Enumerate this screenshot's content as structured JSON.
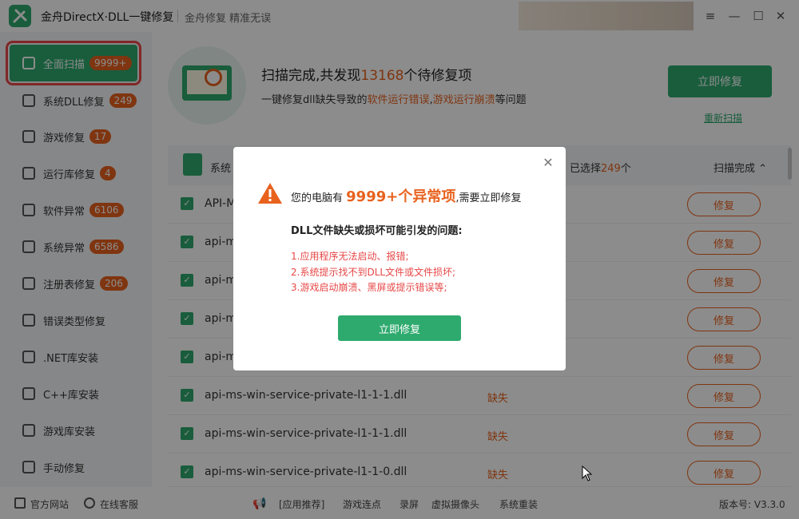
{
  "app": {
    "title": "金舟DirectX·DLL一键修复",
    "slogan": "金舟修复 精准无误",
    "window_controls": [
      "≡",
      "—",
      "☐",
      "✕"
    ]
  },
  "sidebar": {
    "active": {
      "label": "全面扫描",
      "badge": "9999+"
    },
    "items": [
      {
        "label": "系统DLL修复",
        "badge": "249",
        "icon": "dll-icon"
      },
      {
        "label": "游戏修复",
        "badge": "17",
        "icon": "gamepad-icon"
      },
      {
        "label": "运行库修复",
        "badge": "4",
        "icon": "visual-studio-icon"
      },
      {
        "label": "软件异常",
        "badge": "6106",
        "icon": "code-icon"
      },
      {
        "label": "系统异常",
        "badge": "6586",
        "icon": "gear-icon"
      },
      {
        "label": "注册表修复",
        "badge": "206",
        "icon": "registry-icon"
      },
      {
        "label": "错误类型修复",
        "badge": "",
        "icon": "warning-icon"
      },
      {
        "label": ".NET库安装",
        "badge": "",
        "icon": "dotnet-icon"
      },
      {
        "label": "C++库安装",
        "badge": "",
        "icon": "cpp-icon"
      },
      {
        "label": "游戏库安装",
        "badge": "",
        "icon": "pacman-icon"
      },
      {
        "label": "手动修复",
        "badge": "",
        "icon": "tools-icon"
      }
    ]
  },
  "scan": {
    "title_prefix": "扫描完成,共发现",
    "count": "13168",
    "title_suffix": "个待修复项",
    "sub_prefix": "一键修复dll缺失导致的",
    "sub_hl1": "软件运行错误",
    "sub_sep": ",",
    "sub_hl2": "游戏运行崩溃",
    "sub_suffix": "等问题",
    "fix_button": "立即修复",
    "rescan": "重新扫描"
  },
  "list": {
    "col_name": "系统",
    "selected_prefix": "已选择",
    "selected_count": "249",
    "selected_suffix": "个",
    "status": "扫描完成",
    "rows": [
      {
        "name": "API-M",
        "state": "",
        "fix": "修复"
      },
      {
        "name": "api-m",
        "state": "",
        "fix": "修复"
      },
      {
        "name": "api-m",
        "state": "",
        "fix": "修复"
      },
      {
        "name": "api-m",
        "state": "",
        "fix": "修复"
      },
      {
        "name": "api-m",
        "state": "",
        "fix": "修复"
      },
      {
        "name": "api-ms-win-service-private-l1-1-1.dll",
        "state": "缺失",
        "fix": "修复"
      },
      {
        "name": "api-ms-win-service-private-l1-1-1.dll",
        "state": "缺失",
        "fix": "修复"
      },
      {
        "name": "api-ms-win-service-private-l1-1-0.dll",
        "state": "缺失",
        "fix": "修复"
      }
    ]
  },
  "modal": {
    "head_prefix": "您的电脑有",
    "head_count": "9999+个异常项",
    "head_suffix": ",需要立即修复",
    "sub": "DLL文件缺失或损坏可能引发的问题:",
    "issues": [
      "1.应用程序无法启动、报错;",
      "2.系统提示找不到DLL文件或文件损坏;",
      "3.游戏启动崩溃、黑屏或提示错误等;"
    ],
    "button": "立即修复"
  },
  "footer": {
    "website": "官方网站",
    "support": "在线客服",
    "recommend": "[应用推荐]",
    "links": [
      "游戏连点",
      "录屏",
      "虚拟摄像头",
      "系统重装"
    ],
    "version": "版本号: V3.3.0"
  },
  "colors": {
    "brand": "#2eaa6e",
    "accent": "#e8621e",
    "danger": "#e74747"
  }
}
